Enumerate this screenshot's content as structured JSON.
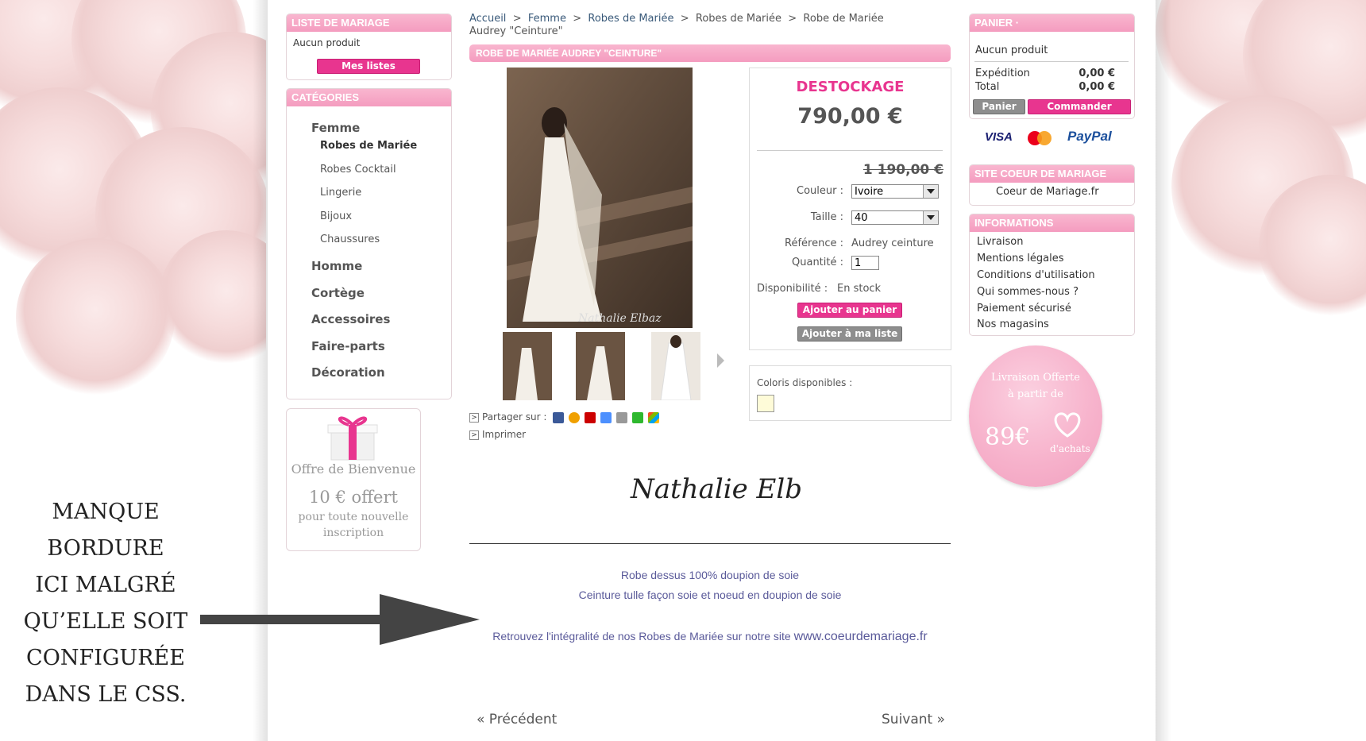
{
  "annotation": {
    "lines": [
      "MANQUE",
      "BORDURE",
      "ICI MALGRÉ",
      "QU’ELLE SOIT",
      "CONFIGURÉE",
      "DANS LE CSS."
    ]
  },
  "wedding_list": {
    "title": "LISTE DE MARIAGE",
    "empty_text": "Aucun produit",
    "button_label": "Mes listes"
  },
  "categories": {
    "title": "CATÉGORIES",
    "items": [
      {
        "label": "Femme"
      },
      {
        "label": "Robes de Mariée"
      },
      {
        "label": "Robes Cocktail"
      },
      {
        "label": "Lingerie"
      },
      {
        "label": "Bijoux"
      },
      {
        "label": "Chaussures"
      },
      {
        "label": "Homme"
      },
      {
        "label": "Cortège"
      },
      {
        "label": "Accessoires"
      },
      {
        "label": "Faire-parts"
      },
      {
        "label": "Décoration"
      }
    ]
  },
  "welcome_offer": {
    "title": "Offre de Bienvenue",
    "amount": "10 € offert",
    "line1": "pour toute nouvelle",
    "line2": "inscription"
  },
  "breadcrumb": {
    "items": [
      "Accueil",
      "Femme",
      "Robes de Mariée",
      "Robes de Mariée",
      "Robe de Mariée Audrey \"Ceinture\""
    ],
    "separator": ">"
  },
  "product": {
    "title": "ROBE DE MARIÉE AUDREY \"CEINTURE\"",
    "badge": "DESTOCKAGE",
    "price": "790,00 €",
    "old_price": "1 190,00 €",
    "color_label": "Couleur :",
    "color_value": "Ivoire",
    "size_label": "Taille :",
    "size_value": "40",
    "reference_label": "Référence :",
    "reference_value": "Audrey ceinture",
    "quantity_label": "Quantité :",
    "quantity_value": "1",
    "availability_label": "Disponibilité :",
    "availability_value": "En stock",
    "add_to_cart_label": "Ajouter au panier",
    "add_to_list_label": "Ajouter à ma liste",
    "colors_available_label": "Coloris disponibles :",
    "swatch_color": "#fefbd8",
    "share_label": "Partager sur :",
    "print_label": "Imprimer",
    "signature": "Nathalie Elbaz",
    "desc_line1": "Robe dessus 100% doupion de soie",
    "desc_line2": "Ceinture tulle façon soie et noeud en doupion de soie",
    "desc_line3": "Retrouvez l'intégralité de nos Robes de Mariée sur notre site",
    "desc_link": "www.coeurdemariage.fr",
    "prev_label": "« Précédent",
    "next_label": "Suivant »"
  },
  "cart": {
    "title": "PANIER ·",
    "empty_text": "Aucun produit",
    "shipping_label": "Expédition",
    "shipping_value": "0,00 €",
    "total_label": "Total",
    "total_value": "0,00 €",
    "cart_button": "Panier",
    "order_button": "Commander",
    "payment": [
      "VISA",
      "PayPal"
    ]
  },
  "site_block": {
    "title": "SITE COEUR DE MARIAGE",
    "link": "Coeur de Mariage.fr"
  },
  "informations": {
    "title": "INFORMATIONS",
    "items": [
      "Livraison",
      "Mentions légales",
      "Conditions d'utilisation",
      "Qui sommes-nous ?",
      "Paiement sécurisé",
      "Nos magasins"
    ]
  },
  "shipping_badge": {
    "line1": "Livraison Offerte",
    "line2": "à partir de",
    "amount": "89€",
    "line3": "d'achats"
  },
  "colors": {
    "pink": "#f49cbf",
    "accent": "#e8358f",
    "title_pink": "#e8358f"
  }
}
